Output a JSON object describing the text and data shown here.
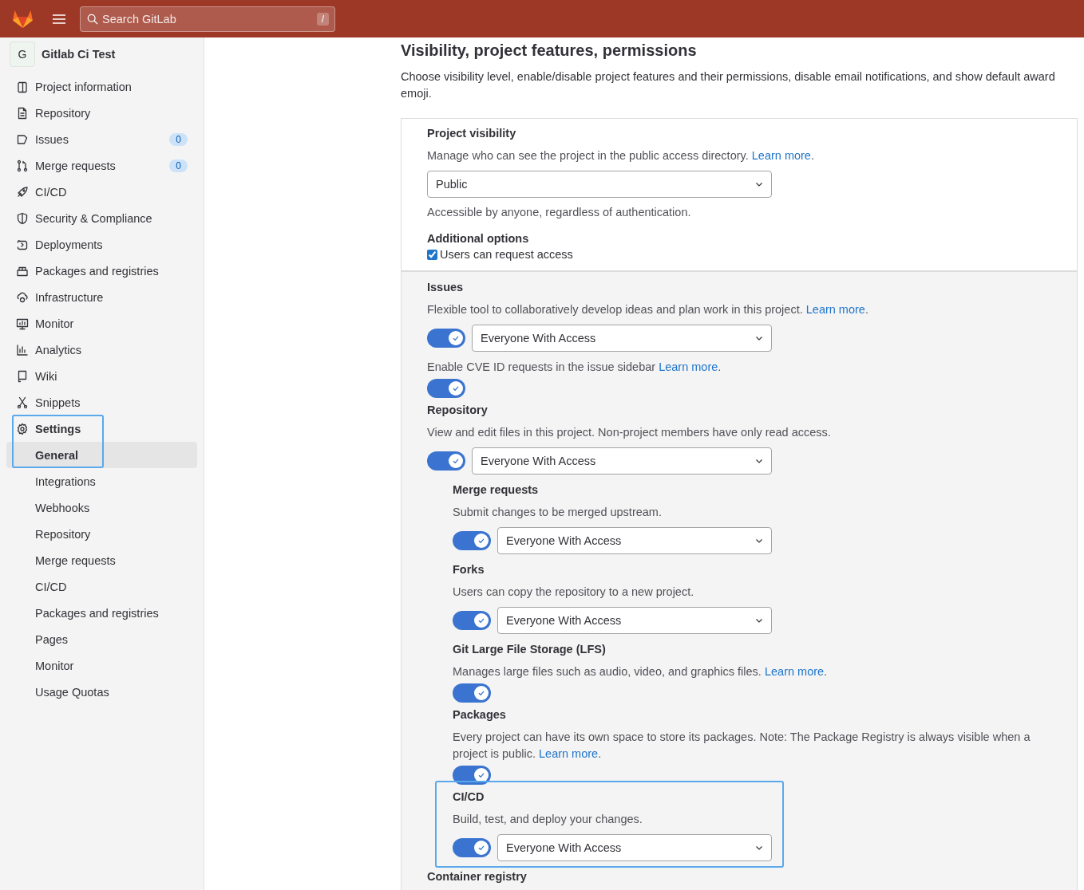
{
  "header": {
    "search": {
      "placeholder": "Search GitLab",
      "shortcut": "/"
    }
  },
  "sidebar": {
    "project": {
      "avatar": "G",
      "name": "Gitlab Ci Test"
    },
    "items": [
      {
        "label": "Project information",
        "selected": false
      },
      {
        "label": "Repository",
        "selected": false
      },
      {
        "label": "Issues",
        "count": "0",
        "selected": false
      },
      {
        "label": "Merge requests",
        "count": "0",
        "selected": false
      },
      {
        "label": "CI/CD",
        "selected": false
      },
      {
        "label": "Security & Compliance",
        "selected": false
      },
      {
        "label": "Deployments",
        "selected": false
      },
      {
        "label": "Packages and registries",
        "selected": false
      },
      {
        "label": "Infrastructure",
        "selected": false
      },
      {
        "label": "Monitor",
        "selected": false
      },
      {
        "label": "Analytics",
        "selected": false
      },
      {
        "label": "Wiki",
        "selected": false
      },
      {
        "label": "Snippets",
        "selected": false
      },
      {
        "label": "Settings",
        "selected": false,
        "expanded": true,
        "highlighted": true,
        "children": [
          {
            "label": "General",
            "selected": true,
            "highlighted": true
          },
          {
            "label": "Integrations",
            "selected": false,
            "highlighted": false
          },
          {
            "label": "Webhooks",
            "selected": false,
            "highlighted": false
          },
          {
            "label": "Repository",
            "selected": false,
            "highlighted": false
          },
          {
            "label": "Merge requests",
            "selected": false,
            "highlighted": false
          },
          {
            "label": "CI/CD",
            "selected": false,
            "highlighted": false
          },
          {
            "label": "Packages and registries",
            "selected": false,
            "highlighted": false
          },
          {
            "label": "Pages",
            "selected": false,
            "highlighted": false
          },
          {
            "label": "Monitor",
            "selected": false,
            "highlighted": false
          },
          {
            "label": "Usage Quotas",
            "selected": false,
            "highlighted": false
          }
        ]
      }
    ]
  },
  "page": {
    "title": "Visibility, project features, permissions",
    "description": "Choose visibility level, enable/disable project features and their permissions, disable email notifications, and show default award emoji."
  },
  "visibility": {
    "title": "Project visibility",
    "description": "Manage who can see the project in the public access directory.",
    "link": "Learn more",
    "after": ".",
    "value": "Public",
    "help": "Accessible by anyone, regardless of authentication.",
    "options_title": "Additional options",
    "checkbox": {
      "label": "Users can request access",
      "checked": true
    }
  },
  "features": [
    {
      "kind": "select",
      "title": "Issues",
      "description": "Flexible tool to collaboratively develop ideas and plan work in this project.",
      "link": "Learn more",
      "after": ".",
      "on": true,
      "access": "Everyone With Access"
    },
    {
      "kind": "toggle",
      "description": "Enable CVE ID requests in the issue sidebar",
      "link": "Learn more",
      "after": ".",
      "on": true
    },
    {
      "kind": "select",
      "title": "Repository",
      "description": "View and edit files in this project. Non-project members have only read access.",
      "on": true,
      "access": "Everyone With Access",
      "children": [
        {
          "kind": "select",
          "title": "Merge requests",
          "description": "Submit changes to be merged upstream.",
          "on": true,
          "access": "Everyone With Access",
          "highlighted": false
        },
        {
          "kind": "select",
          "title": "Forks",
          "description": "Users can copy the repository to a new project.",
          "on": true,
          "access": "Everyone With Access",
          "highlighted": false
        },
        {
          "kind": "toggle",
          "title": "Git Large File Storage (LFS)",
          "description": "Manages large files such as audio, video, and graphics files.",
          "link": "Learn more",
          "after": ".",
          "on": true,
          "highlighted": false
        },
        {
          "kind": "toggle",
          "title": "Packages",
          "description": "Every project can have its own space to store its packages. Note: The Package Registry is always visible when a project is public.",
          "link": "Learn more",
          "after": ".",
          "on": true,
          "highlighted": false
        },
        {
          "kind": "select",
          "title": "CI/CD",
          "description": "Build, test, and deploy your changes.",
          "on": true,
          "access": "Everyone With Access",
          "highlighted": true
        }
      ]
    },
    {
      "kind": "heading",
      "title": "Container registry"
    }
  ]
}
